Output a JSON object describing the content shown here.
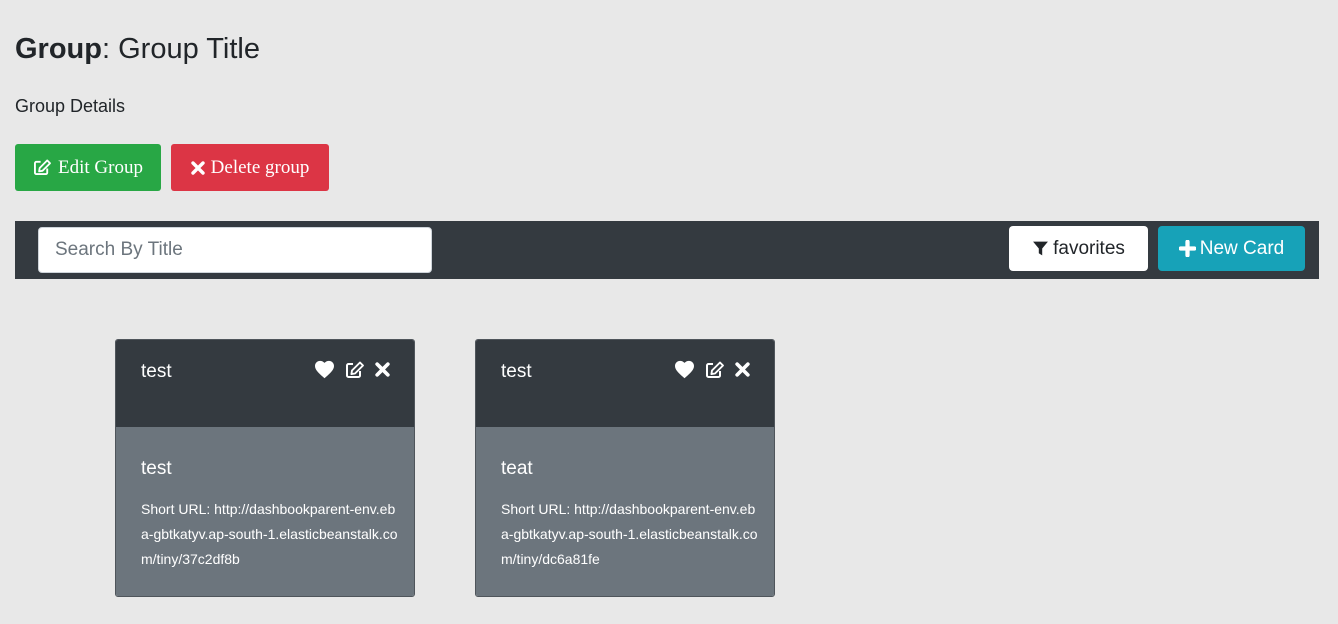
{
  "page": {
    "title_keyword": "Group",
    "title_rest": ": Group Title",
    "details": "Group Details"
  },
  "actions": {
    "edit_label": "Edit Group",
    "delete_label": "Delete group"
  },
  "toolbar": {
    "search_placeholder": "Search By Title",
    "search_value": "",
    "favorites_label": "favorites",
    "new_card_label": "New Card"
  },
  "colors": {
    "background": "#e8e8e8",
    "dark": "#343a40",
    "card_body": "#6c757d",
    "success": "#28a745",
    "danger": "#dc3545",
    "info": "#17a2b8"
  },
  "icons": {
    "edit_group": "edit-icon",
    "delete_group": "times-icon",
    "favorites": "filter-icon",
    "new_card": "plus-icon",
    "card_favorite": "heart-icon",
    "card_edit": "edit-icon",
    "card_delete": "times-icon"
  },
  "cards": [
    {
      "header_title": "test",
      "body_title": "test",
      "short_url": "Short URL: http://dashbookparent-env.eba-gbtkatyv.ap-south-1.elasticbeanstalk.com/tiny/37c2df8b"
    },
    {
      "header_title": "test",
      "body_title": "teat",
      "short_url": "Short URL: http://dashbookparent-env.eba-gbtkatyv.ap-south-1.elasticbeanstalk.com/tiny/dc6a81fe"
    }
  ]
}
